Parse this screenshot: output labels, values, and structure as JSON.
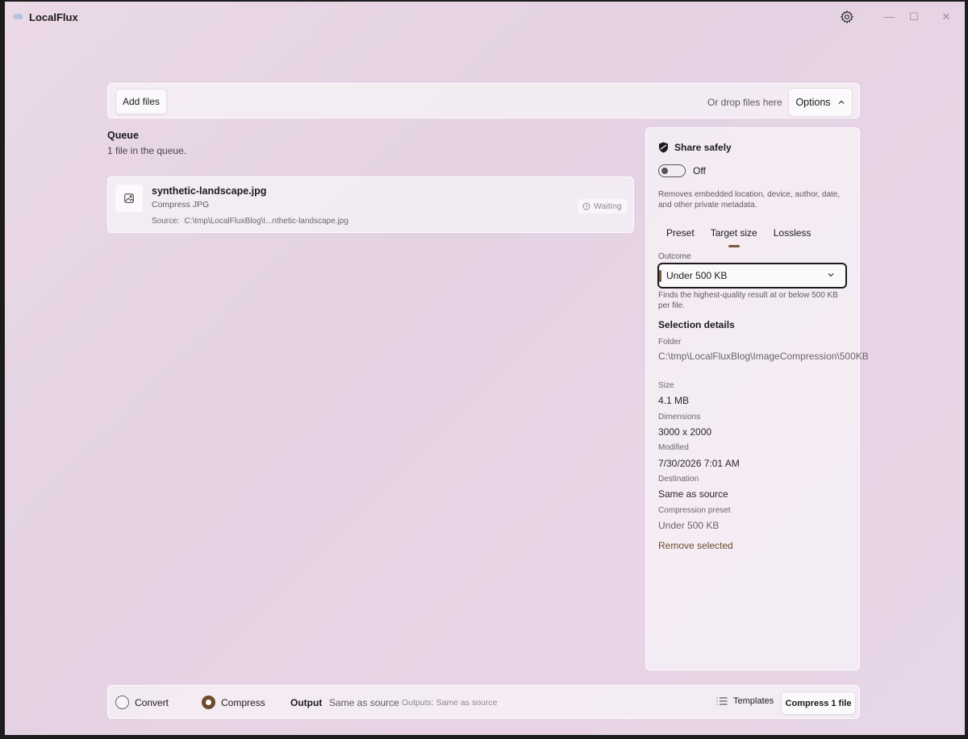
{
  "app": {
    "title": "LocalFlux"
  },
  "window_controls": {
    "minimize": "—",
    "maximize": "☐",
    "close": "✕"
  },
  "toolbar": {
    "add_files_label": "Add files",
    "drop_text": "Or drop files here",
    "options_label": "Options"
  },
  "queue": {
    "title": "Queue",
    "subtitle": "1 file in the queue.",
    "items": [
      {
        "name": "synthetic-landscape.jpg",
        "action": "Compress JPG",
        "source_label": "Source:",
        "source_path": "C:\\tmp\\LocalFluxBlog\\I...nthetic-landscape.jpg",
        "status": "Waiting"
      }
    ]
  },
  "panel": {
    "share_title": "Share safely",
    "toggle_state": "Off",
    "share_description": "Removes embedded location, device, author, date, and other private metadata.",
    "tabs": [
      {
        "label": "Preset",
        "selected": false
      },
      {
        "label": "Target size",
        "selected": true
      },
      {
        "label": "Lossless",
        "selected": false
      }
    ],
    "outcome_label": "Outcome",
    "outcome_value": "Under 500 KB",
    "outcome_hint": "Finds the highest-quality result at or below 500 KB per file.",
    "selection_title": "Selection details",
    "details": {
      "folder_label": "Folder",
      "folder_value": "C:\\tmp\\LocalFluxBlog\\ImageCompression\\500KB",
      "size_label": "Size",
      "size_value": "4.1 MB",
      "dimensions_label": "Dimensions",
      "dimensions_value": "3000 x 2000",
      "modified_label": "Modified",
      "modified_value": "7/30/2026 7:01 AM",
      "destination_label": "Destination",
      "destination_value": "Same as source",
      "preset_label": "Compression preset",
      "preset_value": "Under 500 KB"
    },
    "remove_label": "Remove selected"
  },
  "bottom": {
    "convert_label": "Convert",
    "compress_label": "Compress",
    "mode_selected": "Compress",
    "output_label": "Output",
    "output_value": "Same as source",
    "output_note": "Outputs: Same as source",
    "templates_label": "Templates",
    "compress_button_label": "Compress 1 file"
  },
  "colors": {
    "accent": "#6e4c2a",
    "background": "#e6d4e5"
  }
}
